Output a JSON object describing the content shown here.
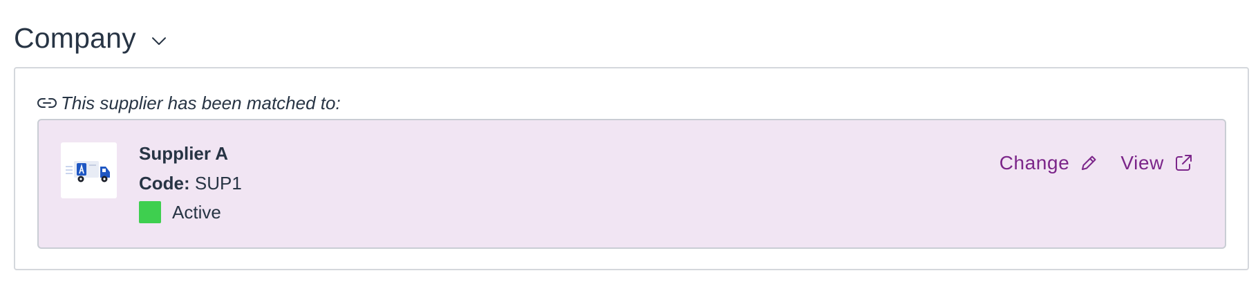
{
  "section": {
    "title": "Company",
    "collapse_icon": "chevron-down-icon"
  },
  "match": {
    "icon": "link-icon",
    "text": "This supplier has been matched to:"
  },
  "supplier": {
    "logo_icon": "delivery-truck-icon",
    "name": "Supplier A",
    "code_label": "Code:",
    "code_value": "SUP1",
    "status": "Active",
    "status_color": "#3ecf4f"
  },
  "actions": {
    "change_label": "Change",
    "change_icon": "pencil-icon",
    "view_label": "View",
    "view_icon": "external-link-icon"
  },
  "colors": {
    "accent": "#7b2589",
    "card_background": "#f1e5f3",
    "text": "#273444"
  }
}
